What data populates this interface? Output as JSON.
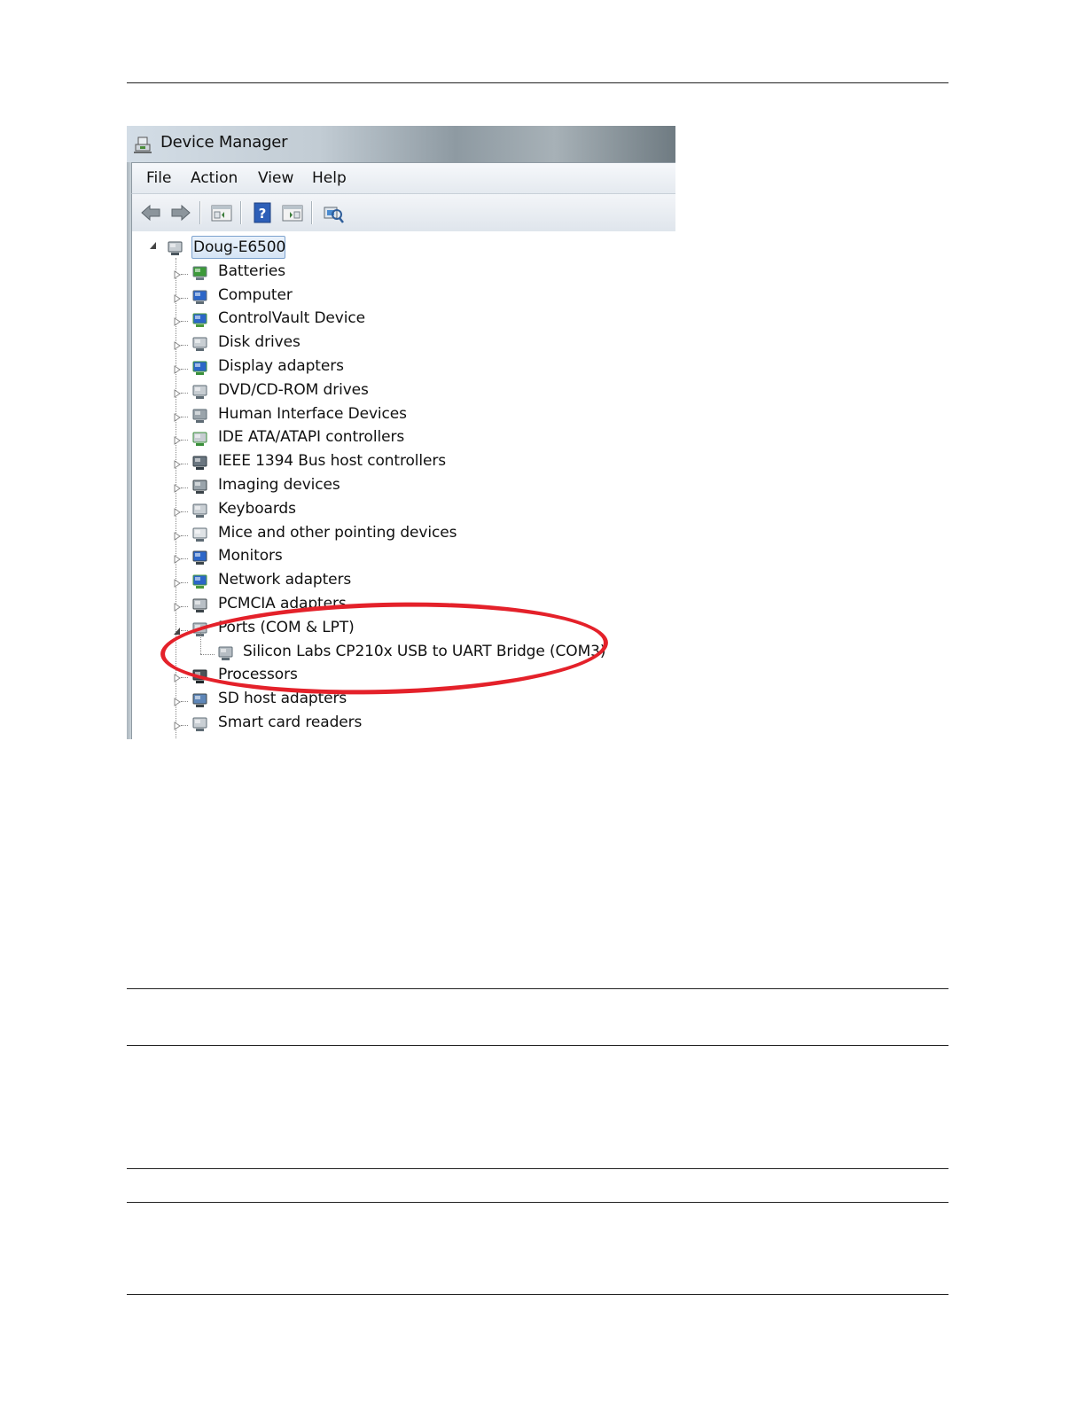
{
  "window": {
    "title": "Device Manager",
    "icon": "device-manager-icon"
  },
  "menu": [
    {
      "label": "File"
    },
    {
      "label": "Action"
    },
    {
      "label": "View"
    },
    {
      "label": "Help"
    }
  ],
  "toolbar": {
    "buttons": [
      "back-arrow-icon",
      "forward-arrow-icon",
      "properties-icon",
      "help-icon",
      "show-hide-icon",
      "scan-hardware-icon"
    ]
  },
  "tree": {
    "root": {
      "label": "Doug-E6500",
      "icon": "computer-root-icon"
    },
    "categories": [
      {
        "label": "Batteries",
        "icon": "battery-icon"
      },
      {
        "label": "Computer",
        "icon": "computer-icon"
      },
      {
        "label": "ControlVault Device",
        "icon": "network-icon"
      },
      {
        "label": "Disk drives",
        "icon": "disk-drive-icon"
      },
      {
        "label": "Display adapters",
        "icon": "display-adapter-icon"
      },
      {
        "label": "DVD/CD-ROM drives",
        "icon": "dvd-drive-icon"
      },
      {
        "label": "Human Interface Devices",
        "icon": "hid-icon"
      },
      {
        "label": "IDE ATA/ATAPI controllers",
        "icon": "ide-controller-icon"
      },
      {
        "label": "IEEE 1394 Bus host controllers",
        "icon": "ieee1394-icon"
      },
      {
        "label": "Imaging devices",
        "icon": "camera-icon"
      },
      {
        "label": "Keyboards",
        "icon": "keyboard-icon"
      },
      {
        "label": "Mice and other pointing devices",
        "icon": "mouse-icon"
      },
      {
        "label": "Monitors",
        "icon": "monitor-icon"
      },
      {
        "label": "Network adapters",
        "icon": "network-adapter-icon"
      },
      {
        "label": "PCMCIA adapters",
        "icon": "pcmcia-icon"
      },
      {
        "label": "Ports (COM & LPT)",
        "icon": "port-icon",
        "expanded": true,
        "children": [
          {
            "label": "Silicon Labs CP210x USB to UART Bridge (COM3)",
            "icon": "serial-port-icon"
          }
        ]
      },
      {
        "label": "Processors",
        "icon": "processor-icon"
      },
      {
        "label": "SD host adapters",
        "icon": "sd-host-icon"
      },
      {
        "label": "Smart card readers",
        "icon": "smart-card-icon"
      }
    ]
  },
  "annotation": {
    "shape": "ellipse",
    "color": "#e4212a"
  }
}
